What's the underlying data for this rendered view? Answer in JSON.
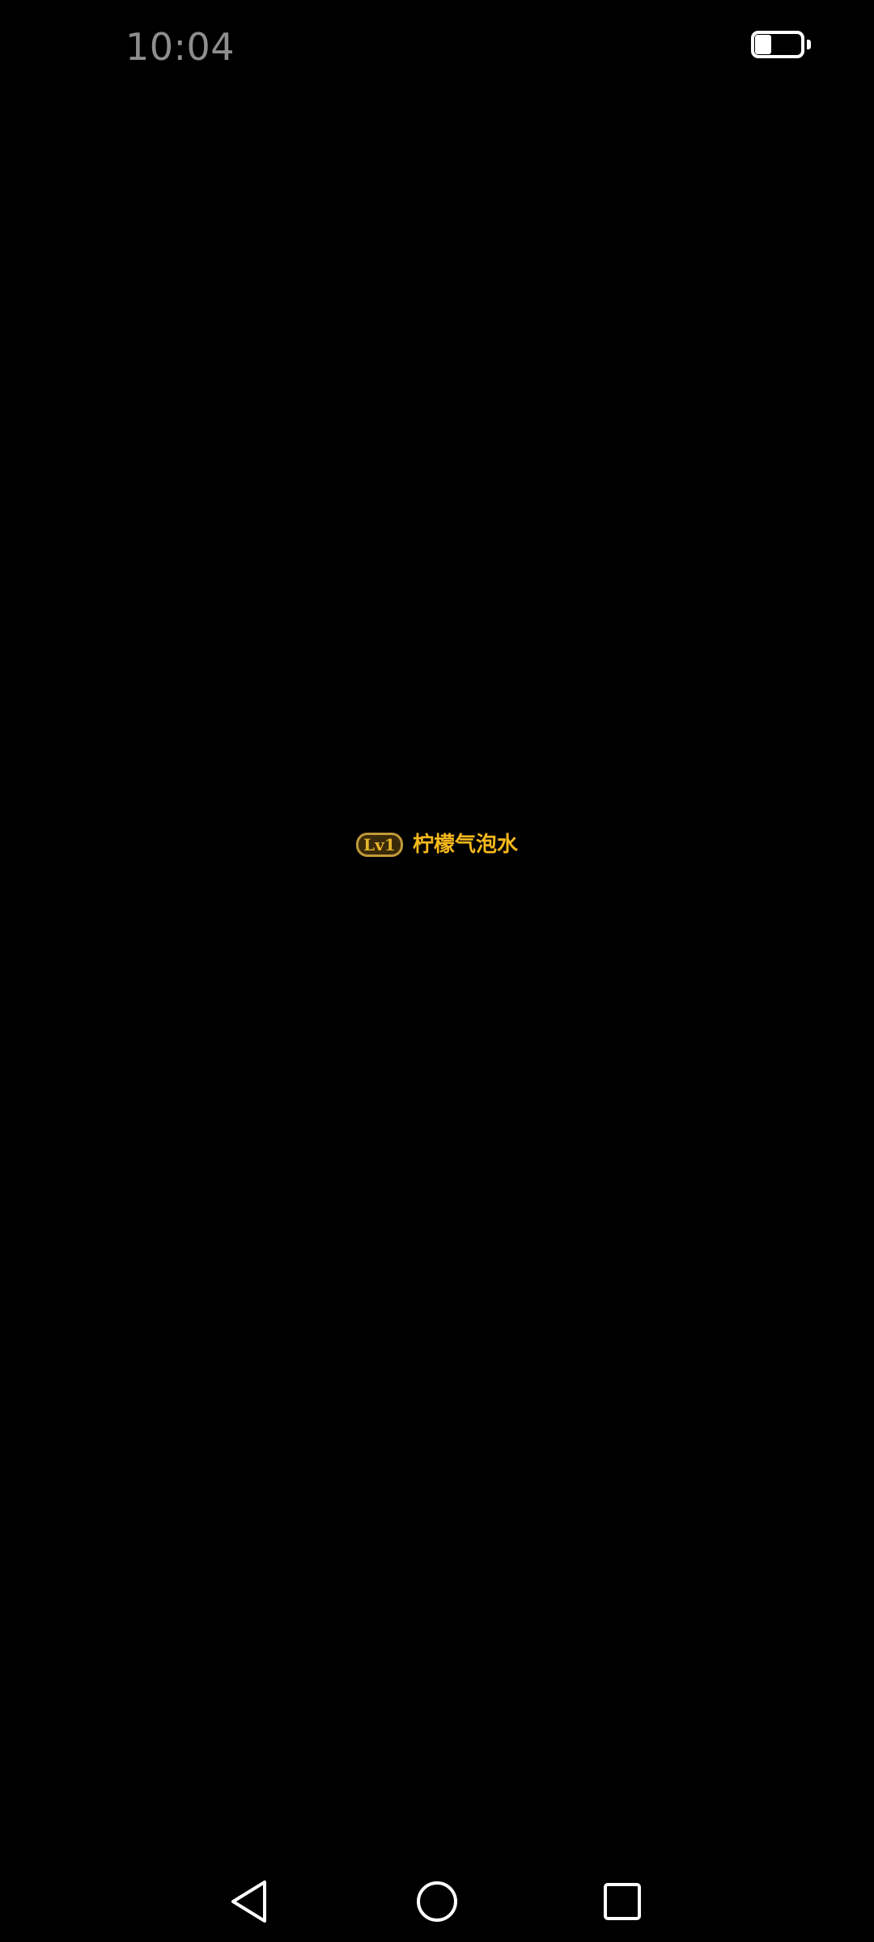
{
  "status_bar": {
    "time": "10:04",
    "battery_icon": "battery-icon",
    "battery_level": 0.35
  },
  "content": {
    "level_badge": "Lv1",
    "nickname": "柠檬气泡水",
    "badge_color": "#c19a3a",
    "name_color": "#f5b81c"
  },
  "nav_bar": {
    "back_icon": "back-triangle-icon",
    "home_icon": "home-circle-icon",
    "recent_icon": "recent-apps-square-icon"
  }
}
